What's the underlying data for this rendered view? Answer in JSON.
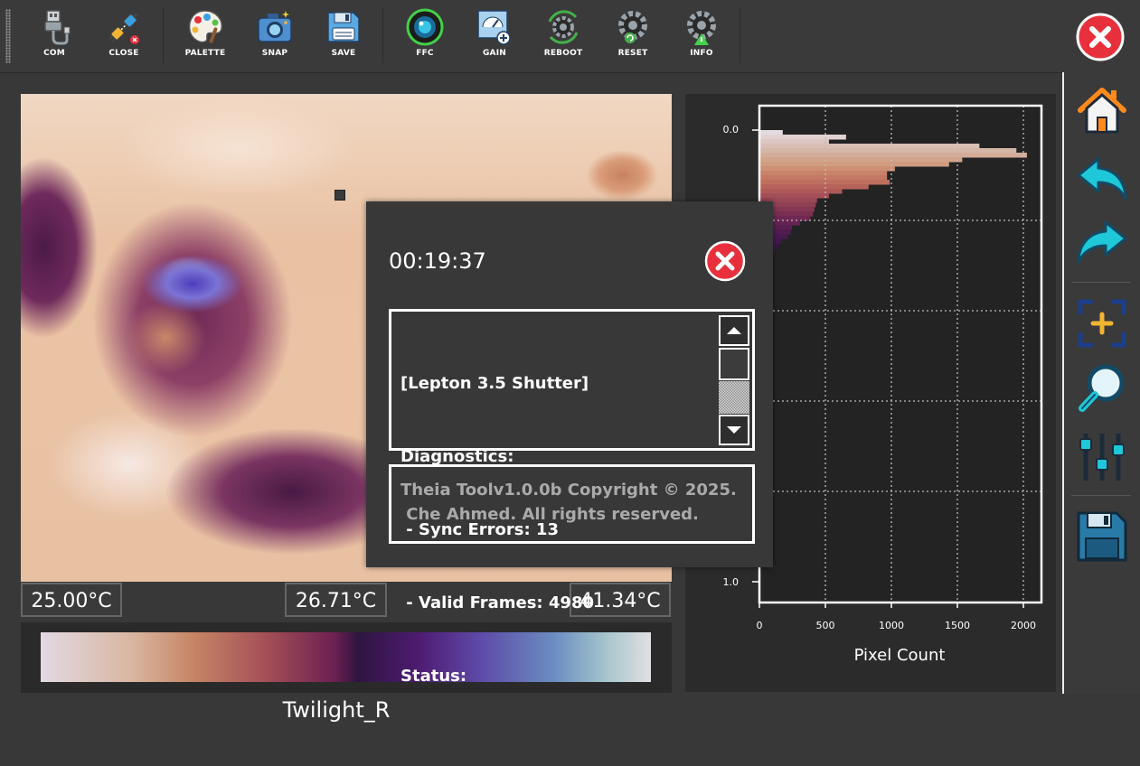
{
  "toolbar": {
    "buttons": [
      {
        "label": "COM",
        "icon": "usb-cable-icon"
      },
      {
        "label": "CLOSE",
        "icon": "disconnect-plug-icon"
      },
      {
        "label": "PALETTE",
        "icon": "palette-icon"
      },
      {
        "label": "SNAP",
        "icon": "camera-icon"
      },
      {
        "label": "SAVE",
        "icon": "floppy-icon"
      },
      {
        "label": "FFC",
        "icon": "lens-icon"
      },
      {
        "label": "GAIN",
        "icon": "gain-meter-icon"
      },
      {
        "label": "REBOOT",
        "icon": "gear-refresh-icon"
      },
      {
        "label": "RESET",
        "icon": "gear-reset-icon"
      },
      {
        "label": "INFO",
        "icon": "gear-info-icon"
      }
    ],
    "close_icon": "close-app-icon"
  },
  "thermal": {
    "min_temp": "25.00°C",
    "center_temp": "26.71°C",
    "max_temp": "41.34°C"
  },
  "palette": {
    "name": "Twilight_R"
  },
  "histogram": {
    "xlabel": "Pixel Count",
    "y_ticks": [
      "0.0",
      "1.0"
    ],
    "x_ticks": [
      "0",
      "500",
      "1000",
      "1500",
      "2000"
    ]
  },
  "chart_data": {
    "type": "bar",
    "orientation": "horizontal",
    "xlabel": "Pixel Count",
    "ylabel": "",
    "xlim": [
      0,
      2150
    ],
    "ylim": [
      0,
      1.0
    ],
    "grid": true,
    "bins": [
      0.0,
      0.01,
      0.02,
      0.03,
      0.04,
      0.05,
      0.06,
      0.07,
      0.08,
      0.09,
      0.1,
      0.11,
      0.12,
      0.13,
      0.14,
      0.15,
      0.16,
      0.17,
      0.18,
      0.19,
      0.2,
      0.21,
      0.22,
      0.23,
      0.24,
      0.25,
      0.26,
      0.27,
      0.28,
      0.29,
      0.3,
      0.31,
      0.32,
      0.33,
      0.34,
      0.35,
      0.36,
      0.37,
      0.38,
      0.39,
      0.4,
      0.41,
      0.42,
      0.43,
      0.44,
      0.45,
      0.46,
      0.47,
      0.48,
      0.49,
      0.5
    ],
    "values": [
      170,
      650,
      520,
      1660,
      1940,
      2020,
      1530,
      1430,
      1020,
      960,
      960,
      980,
      820,
      620,
      520,
      430,
      420,
      410,
      400,
      380,
      300,
      240,
      230,
      210,
      160,
      130,
      110,
      90,
      80,
      60,
      50,
      40,
      30,
      20,
      20,
      15,
      12,
      10,
      8,
      6,
      5,
      4,
      3,
      3,
      2,
      2,
      1,
      1,
      1,
      1,
      1
    ],
    "colors": [
      "#e4dbe0",
      "#e2d2d2",
      "#dcc7c2",
      "#d8bfb5",
      "#d5b7a8",
      "#d3ad99",
      "#d2a48c",
      "#d09c80",
      "#cd9075",
      "#c8836a",
      "#c37963",
      "#be6f5e",
      "#b6645b",
      "#ae5958",
      "#a45056",
      "#9a4855",
      "#904054",
      "#853753",
      "#7a2f52",
      "#6f2852",
      "#652352",
      "#5b1f52",
      "#521c51",
      "#4a1a50",
      "#43194d",
      "#3d184b",
      "#381849",
      "#341848",
      "#301947",
      "#2d1a46",
      "#2b1b46",
      "#2a1c47",
      "#2a1d48",
      "#2a1e49",
      "#2a1f4a",
      "#2b204b",
      "#2b214c",
      "#2c224d",
      "#2c234e",
      "#2d244f",
      "#2d2550",
      "#2e2651",
      "#2e2752",
      "#2f2853",
      "#2f2954",
      "#302a55",
      "#302b56",
      "#312c57",
      "#312d58",
      "#322e59",
      "#322f5a"
    ]
  },
  "sidebar": {
    "buttons": [
      {
        "name": "home",
        "icon": "home-icon"
      },
      {
        "name": "undo",
        "icon": "undo-arrow-icon"
      },
      {
        "name": "redo",
        "icon": "redo-arrow-icon"
      },
      {
        "name": "zoom-region",
        "icon": "add-region-icon"
      },
      {
        "name": "zoom",
        "icon": "magnifier-icon"
      },
      {
        "name": "adjust",
        "icon": "sliders-icon"
      },
      {
        "name": "save",
        "icon": "floppy-icon"
      }
    ]
  },
  "dialog": {
    "time": "00:19:37",
    "log_lines": [
      "[Lepton 3.5 Shutter]",
      "Diagnostics:",
      " - Sync Errors: 13",
      " - Valid Frames: 4980",
      "Status:"
    ],
    "copyright_lines": [
      "Theia Toolv1.0.0b Copyright © 2025.",
      " Che Ahmed. All rights reserved."
    ]
  },
  "colors": {
    "accent_red": "#e8303d",
    "accent_cyan": "#1ec8d8",
    "accent_blue": "#1c3f8a"
  }
}
